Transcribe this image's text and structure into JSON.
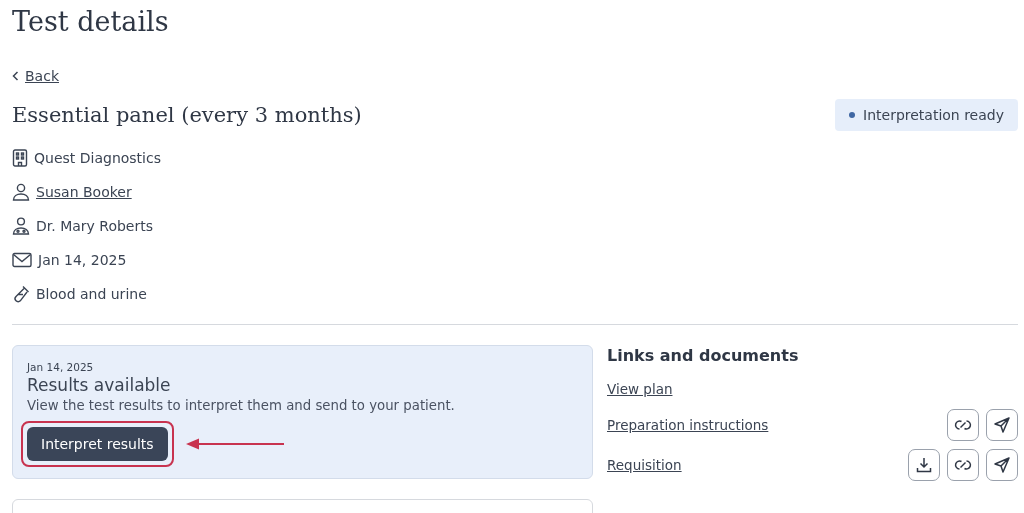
{
  "page_title": "Test details",
  "back_link": "Back",
  "test_name": "Essential panel (every 3 months)",
  "status_badge": {
    "label": "Interpretation ready",
    "color": "#3f67a3"
  },
  "details": [
    {
      "kind": "building",
      "text": "Quest Diagnostics",
      "link": false
    },
    {
      "kind": "person",
      "text": "Susan Booker",
      "link": true
    },
    {
      "kind": "doctor",
      "text": "Dr. Mary Roberts",
      "link": false
    },
    {
      "kind": "mail",
      "text": "Jan 14, 2025",
      "link": false
    },
    {
      "kind": "tube",
      "text": "Blood and urine",
      "link": false
    }
  ],
  "result_card": {
    "date": "Jan 14, 2025",
    "title": "Results available",
    "description": "View the test results to interpret them and send to your patient.",
    "button": {
      "label": "Interpret results",
      "highlighted": true
    }
  },
  "links_and_documents": {
    "heading": "Links and documents",
    "items": [
      {
        "label": "View plan"
      },
      {
        "label": "Preparation instructions",
        "actions": [
          {
            "kind": "link"
          },
          {
            "kind": "send"
          }
        ]
      },
      {
        "label": "Requisition",
        "actions": [
          {
            "kind": "download"
          },
          {
            "kind": "link"
          },
          {
            "kind": "send"
          }
        ]
      }
    ]
  }
}
